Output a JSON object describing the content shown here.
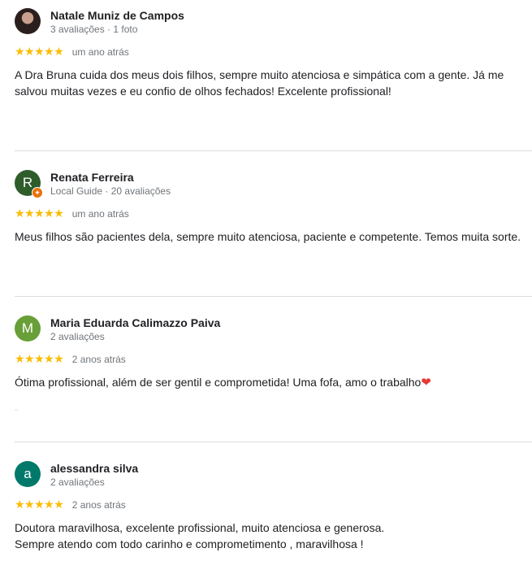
{
  "reviews": [
    {
      "name": "Natale Muniz de Campos",
      "meta": "3 avaliações · 1 foto",
      "avatar_type": "photo",
      "avatar_letter": "",
      "avatar_color": "#2a1f1d",
      "stars": "★★★★★",
      "rating": 5,
      "time": "um ano atrás",
      "text": "A Dra Bruna cuida dos meus dois filhos, sempre muito atenciosa e simpática com a gente. Já me salvou muitas vezes e eu confio de olhos fechados! Excelente profissional!"
    },
    {
      "name": "Renata Ferreira",
      "meta": "Local Guide · 20 avaliações",
      "avatar_type": "letter",
      "avatar_letter": "R",
      "avatar_color": "#2e5d2a",
      "badge": "✦",
      "stars": "★★★★★",
      "rating": 5,
      "time": "um ano atrás",
      "text": "Meus filhos são pacientes dela, sempre muito atenciosa, paciente e competente. Temos muita sorte."
    },
    {
      "name": "Maria Eduarda Calimazzo Paiva",
      "meta": "2 avaliações",
      "avatar_type": "letter",
      "avatar_letter": "M",
      "avatar_color": "#689f38",
      "stars": "★★★★★",
      "rating": 5,
      "time": "2 anos atrás",
      "text": "Ótima profissional, além de ser gentil e comprometida! Uma fofa, amo o trabalho",
      "emoji": "❤"
    },
    {
      "name": "alessandra silva",
      "meta": "2 avaliações",
      "avatar_type": "letter",
      "avatar_letter": "a",
      "avatar_color": "#00796b",
      "stars": "★★★★★",
      "rating": 5,
      "time": "2 anos atrás",
      "text": "Doutora maravilhosa, excelente profissional, muito atenciosa e generosa.\nSempre atendo com todo carinho e comprometimento , maravilhosa !"
    }
  ]
}
